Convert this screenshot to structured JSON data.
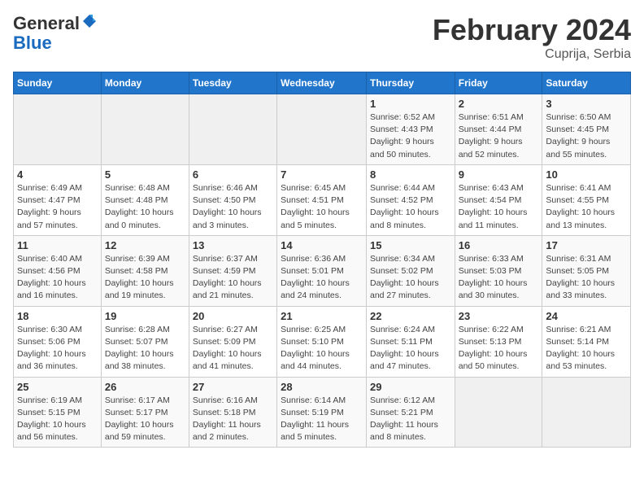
{
  "header": {
    "logo_general": "General",
    "logo_blue": "Blue",
    "month_title": "February 2024",
    "location": "Cuprija, Serbia"
  },
  "weekdays": [
    "Sunday",
    "Monday",
    "Tuesday",
    "Wednesday",
    "Thursday",
    "Friday",
    "Saturday"
  ],
  "weeks": [
    [
      {
        "day": "",
        "info": ""
      },
      {
        "day": "",
        "info": ""
      },
      {
        "day": "",
        "info": ""
      },
      {
        "day": "",
        "info": ""
      },
      {
        "day": "1",
        "info": "Sunrise: 6:52 AM\nSunset: 4:43 PM\nDaylight: 9 hours\nand 50 minutes."
      },
      {
        "day": "2",
        "info": "Sunrise: 6:51 AM\nSunset: 4:44 PM\nDaylight: 9 hours\nand 52 minutes."
      },
      {
        "day": "3",
        "info": "Sunrise: 6:50 AM\nSunset: 4:45 PM\nDaylight: 9 hours\nand 55 minutes."
      }
    ],
    [
      {
        "day": "4",
        "info": "Sunrise: 6:49 AM\nSunset: 4:47 PM\nDaylight: 9 hours\nand 57 minutes."
      },
      {
        "day": "5",
        "info": "Sunrise: 6:48 AM\nSunset: 4:48 PM\nDaylight: 10 hours\nand 0 minutes."
      },
      {
        "day": "6",
        "info": "Sunrise: 6:46 AM\nSunset: 4:50 PM\nDaylight: 10 hours\nand 3 minutes."
      },
      {
        "day": "7",
        "info": "Sunrise: 6:45 AM\nSunset: 4:51 PM\nDaylight: 10 hours\nand 5 minutes."
      },
      {
        "day": "8",
        "info": "Sunrise: 6:44 AM\nSunset: 4:52 PM\nDaylight: 10 hours\nand 8 minutes."
      },
      {
        "day": "9",
        "info": "Sunrise: 6:43 AM\nSunset: 4:54 PM\nDaylight: 10 hours\nand 11 minutes."
      },
      {
        "day": "10",
        "info": "Sunrise: 6:41 AM\nSunset: 4:55 PM\nDaylight: 10 hours\nand 13 minutes."
      }
    ],
    [
      {
        "day": "11",
        "info": "Sunrise: 6:40 AM\nSunset: 4:56 PM\nDaylight: 10 hours\nand 16 minutes."
      },
      {
        "day": "12",
        "info": "Sunrise: 6:39 AM\nSunset: 4:58 PM\nDaylight: 10 hours\nand 19 minutes."
      },
      {
        "day": "13",
        "info": "Sunrise: 6:37 AM\nSunset: 4:59 PM\nDaylight: 10 hours\nand 21 minutes."
      },
      {
        "day": "14",
        "info": "Sunrise: 6:36 AM\nSunset: 5:01 PM\nDaylight: 10 hours\nand 24 minutes."
      },
      {
        "day": "15",
        "info": "Sunrise: 6:34 AM\nSunset: 5:02 PM\nDaylight: 10 hours\nand 27 minutes."
      },
      {
        "day": "16",
        "info": "Sunrise: 6:33 AM\nSunset: 5:03 PM\nDaylight: 10 hours\nand 30 minutes."
      },
      {
        "day": "17",
        "info": "Sunrise: 6:31 AM\nSunset: 5:05 PM\nDaylight: 10 hours\nand 33 minutes."
      }
    ],
    [
      {
        "day": "18",
        "info": "Sunrise: 6:30 AM\nSunset: 5:06 PM\nDaylight: 10 hours\nand 36 minutes."
      },
      {
        "day": "19",
        "info": "Sunrise: 6:28 AM\nSunset: 5:07 PM\nDaylight: 10 hours\nand 38 minutes."
      },
      {
        "day": "20",
        "info": "Sunrise: 6:27 AM\nSunset: 5:09 PM\nDaylight: 10 hours\nand 41 minutes."
      },
      {
        "day": "21",
        "info": "Sunrise: 6:25 AM\nSunset: 5:10 PM\nDaylight: 10 hours\nand 44 minutes."
      },
      {
        "day": "22",
        "info": "Sunrise: 6:24 AM\nSunset: 5:11 PM\nDaylight: 10 hours\nand 47 minutes."
      },
      {
        "day": "23",
        "info": "Sunrise: 6:22 AM\nSunset: 5:13 PM\nDaylight: 10 hours\nand 50 minutes."
      },
      {
        "day": "24",
        "info": "Sunrise: 6:21 AM\nSunset: 5:14 PM\nDaylight: 10 hours\nand 53 minutes."
      }
    ],
    [
      {
        "day": "25",
        "info": "Sunrise: 6:19 AM\nSunset: 5:15 PM\nDaylight: 10 hours\nand 56 minutes."
      },
      {
        "day": "26",
        "info": "Sunrise: 6:17 AM\nSunset: 5:17 PM\nDaylight: 10 hours\nand 59 minutes."
      },
      {
        "day": "27",
        "info": "Sunrise: 6:16 AM\nSunset: 5:18 PM\nDaylight: 11 hours\nand 2 minutes."
      },
      {
        "day": "28",
        "info": "Sunrise: 6:14 AM\nSunset: 5:19 PM\nDaylight: 11 hours\nand 5 minutes."
      },
      {
        "day": "29",
        "info": "Sunrise: 6:12 AM\nSunset: 5:21 PM\nDaylight: 11 hours\nand 8 minutes."
      },
      {
        "day": "",
        "info": ""
      },
      {
        "day": "",
        "info": ""
      }
    ]
  ]
}
